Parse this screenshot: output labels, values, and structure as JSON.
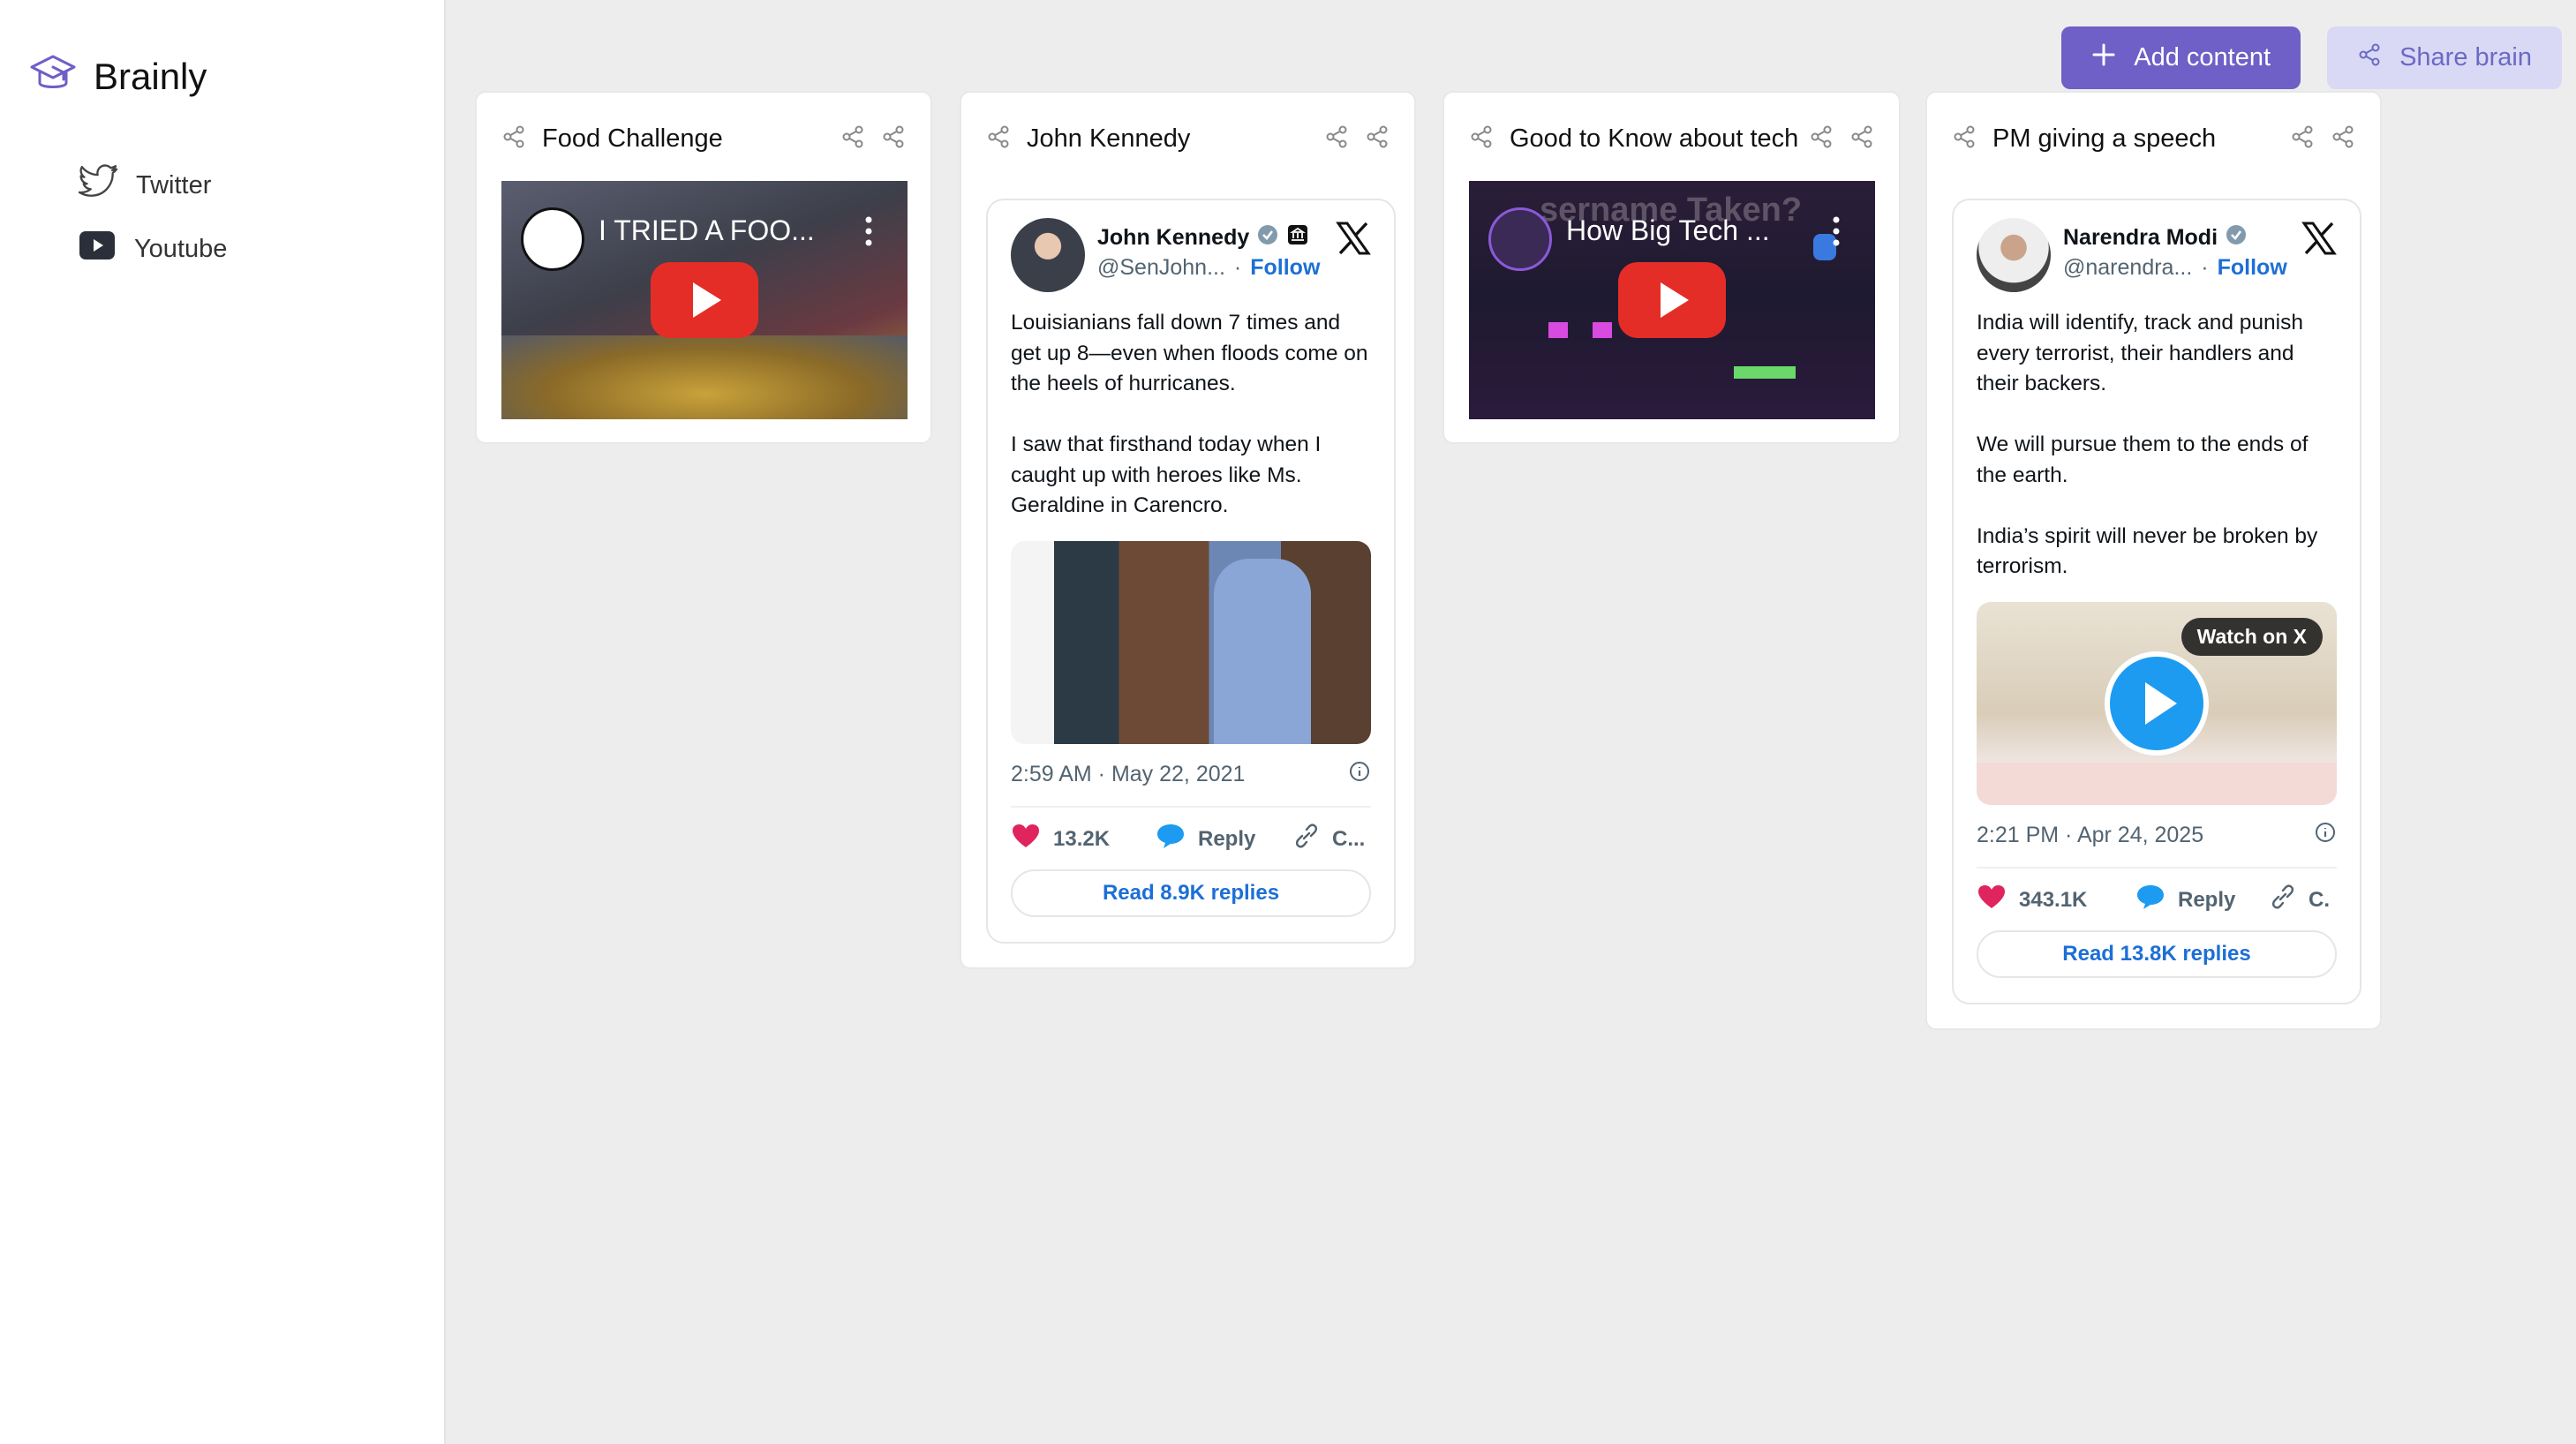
{
  "app": {
    "name": "Brainly"
  },
  "sidebar": {
    "items": [
      {
        "label": "Twitter",
        "icon": "twitter-icon"
      },
      {
        "label": "Youtube",
        "icon": "youtube-icon"
      }
    ]
  },
  "toolbar": {
    "add_label": "Add content",
    "share_label": "Share brain"
  },
  "colors": {
    "accent": "#6e60c6",
    "accent_soft": "#d9d9f5",
    "link": "#1d6fd6",
    "youtube_red": "#e52d27",
    "like": "#e0245e"
  },
  "cards": [
    {
      "title": "Food Challenge",
      "type": "youtube",
      "video_title": "I TRIED A FOO..."
    },
    {
      "title": "John Kennedy",
      "type": "tweet",
      "tweet": {
        "name": "John Kennedy",
        "handle": "@SenJohn...",
        "follow": "Follow",
        "text": "Louisianians fall down 7 times and get up 8—even when floods come on the heels of hurricanes.\n\nI saw that firsthand today when I caught up with heroes like Ms. Geraldine in Carencro.",
        "time": "2:59 AM · May 22, 2021",
        "likes": "13.2K",
        "reply": "Reply",
        "copy": "C...",
        "read_replies": "Read 8.9K replies"
      }
    },
    {
      "title": "Good to Know about tech",
      "type": "youtube",
      "video_title": "How Big Tech ...",
      "overlay_text": "sername Taken?"
    },
    {
      "title": "PM giving a speech",
      "type": "tweet",
      "tweet": {
        "name": "Narendra Modi",
        "handle": "@narendra...",
        "follow": "Follow",
        "text": "India will identify, track and punish every terrorist, their handlers and their backers.\n\nWe will pursue them to the ends of the earth.\n\nIndia’s spirit will never be broken by terrorism.",
        "watch_on_x": "Watch on X",
        "time": "2:21 PM · Apr 24, 2025",
        "likes": "343.1K",
        "reply": "Reply",
        "copy": "C.",
        "read_replies": "Read 13.8K replies"
      }
    }
  ]
}
